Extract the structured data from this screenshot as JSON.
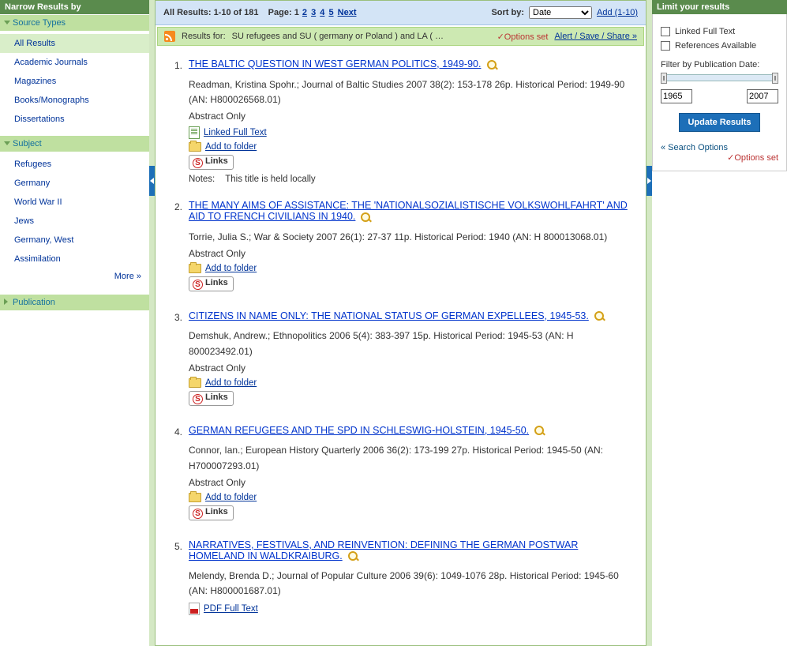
{
  "narrow_header": "Narrow Results by",
  "facets": {
    "source_types": {
      "label": "Source Types",
      "items": [
        "All Results",
        "Academic Journals",
        "Magazines",
        "Books/Monographs",
        "Dissertations"
      ],
      "selected_index": 0
    },
    "subject": {
      "label": "Subject",
      "items": [
        "Refugees",
        "Germany",
        "World War II",
        "Jews",
        "Germany, West",
        "Assimilation"
      ],
      "more_label": "More »"
    },
    "publication": {
      "label": "Publication"
    }
  },
  "results_header": {
    "all_results_label": "All Results: 1-10 of 181",
    "page_label": "Page:",
    "current_page": "1",
    "pages": [
      "2",
      "3",
      "4",
      "5"
    ],
    "next_label": "Next",
    "sort_by_label": "Sort by:",
    "sort_value": "Date",
    "add_label": "Add (1-10)"
  },
  "query_bar": {
    "results_for": "Results for:",
    "query": "SU refugees and SU ( germany or Poland ) and LA ( …",
    "options_set": "✓Options set",
    "alert": "Alert / Save / Share »"
  },
  "results": [
    {
      "num": "1.",
      "title": "THE BALTIC QUESTION IN WEST GERMAN POLITICS, 1949-90.",
      "meta": "Readman, Kristina Spohr.; Journal of Baltic Studies 2007 38(2): 153-178 26p. Historical Period: 1949-90 (AN: H800026568.01)",
      "abstract": "Abstract Only",
      "linked_full_text": "Linked Full Text",
      "add_folder": "Add to folder",
      "links": "Links",
      "notes_label": "Notes:",
      "notes_text": "This title is held locally"
    },
    {
      "num": "2.",
      "title": "THE MANY AIMS OF ASSISTANCE: THE 'NATIONALSOZIALISTISCHE VOLKSWOHLFAHRT' AND AID TO FRENCH CIVILIANS IN 1940.",
      "meta": "Torrie, Julia S.; War & Society 2007 26(1): 27-37 11p. Historical Period: 1940 (AN: H 800013068.01)",
      "abstract": "Abstract Only",
      "add_folder": "Add to folder",
      "links": "Links"
    },
    {
      "num": "3.",
      "title": "CITIZENS IN NAME ONLY: THE NATIONAL STATUS OF GERMAN EXPELLEES, 1945-53.",
      "meta": "Demshuk, Andrew.; Ethnopolitics 2006 5(4): 383-397 15p. Historical Period: 1945-53 (AN: H 800023492.01)",
      "abstract": "Abstract Only",
      "add_folder": "Add to folder",
      "links": "Links"
    },
    {
      "num": "4.",
      "title": "GERMAN REFUGEES AND THE SPD IN SCHLESWIG-HOLSTEIN, 1945-50.",
      "meta": "Connor, Ian.; European History Quarterly 2006 36(2): 173-199 27p. Historical Period: 1945-50 (AN: H700007293.01)",
      "abstract": "Abstract Only",
      "add_folder": "Add to folder",
      "links": "Links"
    },
    {
      "num": "5.",
      "title": "NARRATIVES, FESTIVALS, AND REINVENTION: DEFINING THE GERMAN POSTWAR HOMELAND IN WALDKRAIBURG.",
      "meta": "Melendy, Brenda D.; Journal of Popular Culture 2006 39(6): 1049-1076 28p. Historical Period: 1945-60 (AN: H800001687.01)",
      "pdf_full_text": "PDF Full Text"
    }
  ],
  "right": {
    "header": "Limit your results",
    "linked_full_text": "Linked Full Text",
    "references_available": "References Available",
    "filter_date_label": "Filter by Publication Date:",
    "year_from": "1965",
    "year_to": "2007",
    "update_btn": "Update Results",
    "search_options": "« Search Options",
    "options_set": "✓Options set"
  }
}
